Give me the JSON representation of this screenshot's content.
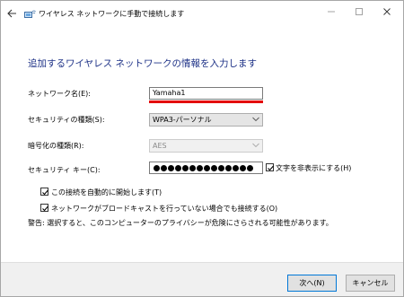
{
  "window": {
    "title": "ワイヤレス ネットワークに手動で接続します",
    "back_icon": "back-arrow-icon",
    "app_icon": "network-icon",
    "controls": [
      "minimize-icon",
      "maximize-icon",
      "close-icon"
    ]
  },
  "heading": "追加するワイヤレス ネットワークの情報を入力します",
  "form": {
    "network_name_label": "ネットワーク名(E):",
    "network_name_value": "Yamaha1",
    "security_type_label": "セキュリティの種類(S):",
    "security_type_value": "WPA3-パーソナル",
    "encryption_type_label": "暗号化の種類(R):",
    "encryption_type_value": "AES",
    "security_key_label": "セキュリティ キー(C):",
    "security_key_masked_length": 14,
    "hide_characters_label": "文字を非表示にする(H)",
    "hide_characters_checked": true,
    "auto_connect_label": "この接続を自動的に開始します(T)",
    "auto_connect_checked": true,
    "broadcast_label": "ネットワークがブロードキャストを行っていない場合でも接続する(O)",
    "broadcast_checked": true,
    "warning_text": "警告: 選択すると、このコンピューターのプライバシーが危険にさらされる可能性があります。"
  },
  "footer": {
    "next_label": "次へ(N)",
    "cancel_label": "キャンセル"
  },
  "colors": {
    "heading": "#1e3287",
    "highlight_underline": "#e30000",
    "default_button_border": "#0078d7"
  }
}
